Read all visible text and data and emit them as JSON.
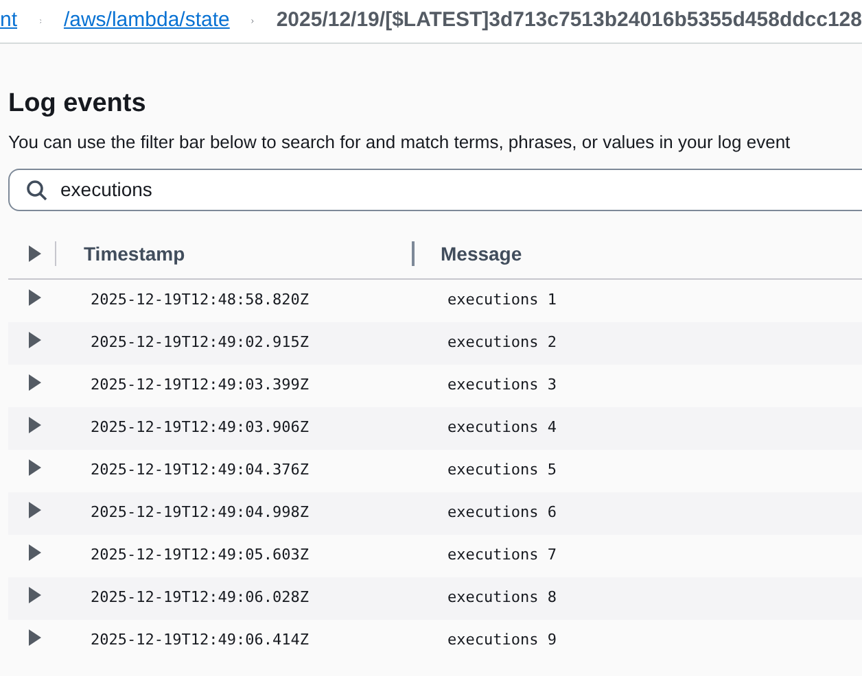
{
  "breadcrumbs": [
    {
      "label": "nt",
      "link": true
    },
    {
      "label": "/aws/lambda/state",
      "link": true
    },
    {
      "label": "2025/12/19/[$LATEST]3d713c7513b24016b5355d458ddcc128",
      "link": false
    }
  ],
  "heading": "Log events",
  "description": "You can use the filter bar below to search for and match terms, phrases, or values in your log event",
  "search": {
    "value": "executions"
  },
  "table": {
    "columns": [
      "Timestamp",
      "Message"
    ],
    "rows": [
      {
        "timestamp": "2025-12-19T12:48:58.820Z",
        "message": "executions 1",
        "expanded": false
      },
      {
        "timestamp": "2025-12-19T12:49:02.915Z",
        "message": "executions 2",
        "expanded": false
      },
      {
        "timestamp": "2025-12-19T12:49:03.399Z",
        "message": "executions 3",
        "expanded": false
      },
      {
        "timestamp": "2025-12-19T12:49:03.906Z",
        "message": "executions 4",
        "expanded": false
      },
      {
        "timestamp": "2025-12-19T12:49:04.376Z",
        "message": "executions 5",
        "expanded": false
      },
      {
        "timestamp": "2025-12-19T12:49:04.998Z",
        "message": "executions 6",
        "expanded": false
      },
      {
        "timestamp": "2025-12-19T12:49:05.603Z",
        "message": "executions 7",
        "expanded": false
      },
      {
        "timestamp": "2025-12-19T12:49:06.028Z",
        "message": "executions 8",
        "expanded": false
      },
      {
        "timestamp": "2025-12-19T12:49:06.414Z",
        "message": "executions 9",
        "expanded": false
      }
    ]
  }
}
